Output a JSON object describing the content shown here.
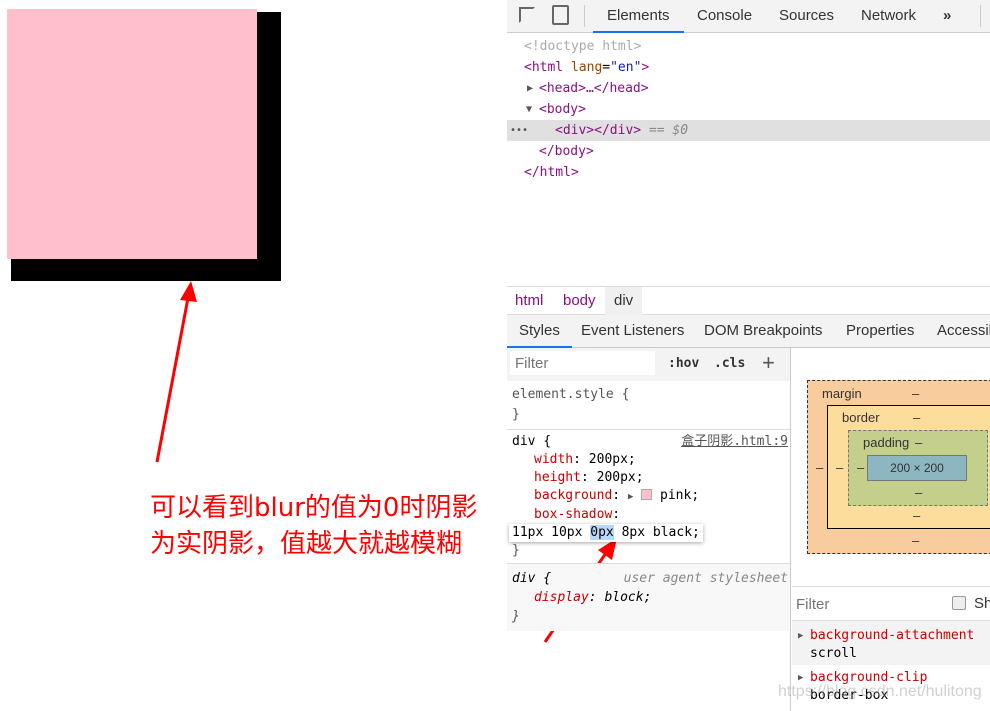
{
  "demo": {
    "box_color": "#ffc0cb",
    "shadow_color": "#000000"
  },
  "note": {
    "text": "可以看到blur的值为0时阴影为实阴影，值越大就越模糊",
    "color": "#ff0000"
  },
  "devtools": {
    "tabs": [
      "Elements",
      "Console",
      "Sources",
      "Network",
      "»"
    ],
    "active_tab": "Elements",
    "dom": {
      "doctype": "<!doctype html>",
      "html_open": "<html",
      "lang_attr": "lang",
      "lang_val": "\"en\"",
      "head": "<head>…</head>",
      "body_open": "<body>",
      "div": "<div></div>",
      "selected_marker": "== $0",
      "body_close": "</body>",
      "html_close": "</html>",
      "dots": "•••"
    },
    "breadcrumb": [
      "html",
      "body",
      "div"
    ],
    "subtabs": [
      "Styles",
      "Event Listeners",
      "DOM Breakpoints",
      "Properties",
      "Accessib"
    ],
    "filter_placeholder": "Filter",
    "hov": ":hov",
    "cls": ".cls",
    "plus": "+",
    "element_style": "element.style {",
    "close_brace": "}",
    "rule": {
      "selector": "div {",
      "source": "盒子阴影.html:9",
      "props": [
        [
          "width",
          "200px;"
        ],
        [
          "height",
          "200px;"
        ],
        [
          "background",
          "pink;"
        ],
        [
          "box-shadow",
          ""
        ]
      ],
      "shadow_edit": [
        "11px 10px ",
        "0px",
        " 8px black;"
      ]
    },
    "ua_rule": {
      "selector": "div {",
      "source": "user agent stylesheet",
      "prop": "display",
      "value": "block;"
    },
    "boxmodel": {
      "margin": "margin",
      "border": "border",
      "padding": "padding",
      "content": "200 × 200",
      "dash": "–"
    },
    "computed": {
      "filter_placeholder": "Filter",
      "show_all": "Sh",
      "items": [
        {
          "name": "background-attachment",
          "value": "scroll"
        },
        {
          "name": "background-clip",
          "value": "border-box"
        }
      ]
    }
  },
  "watermark": "https://blog.csdn.net/hulitong"
}
